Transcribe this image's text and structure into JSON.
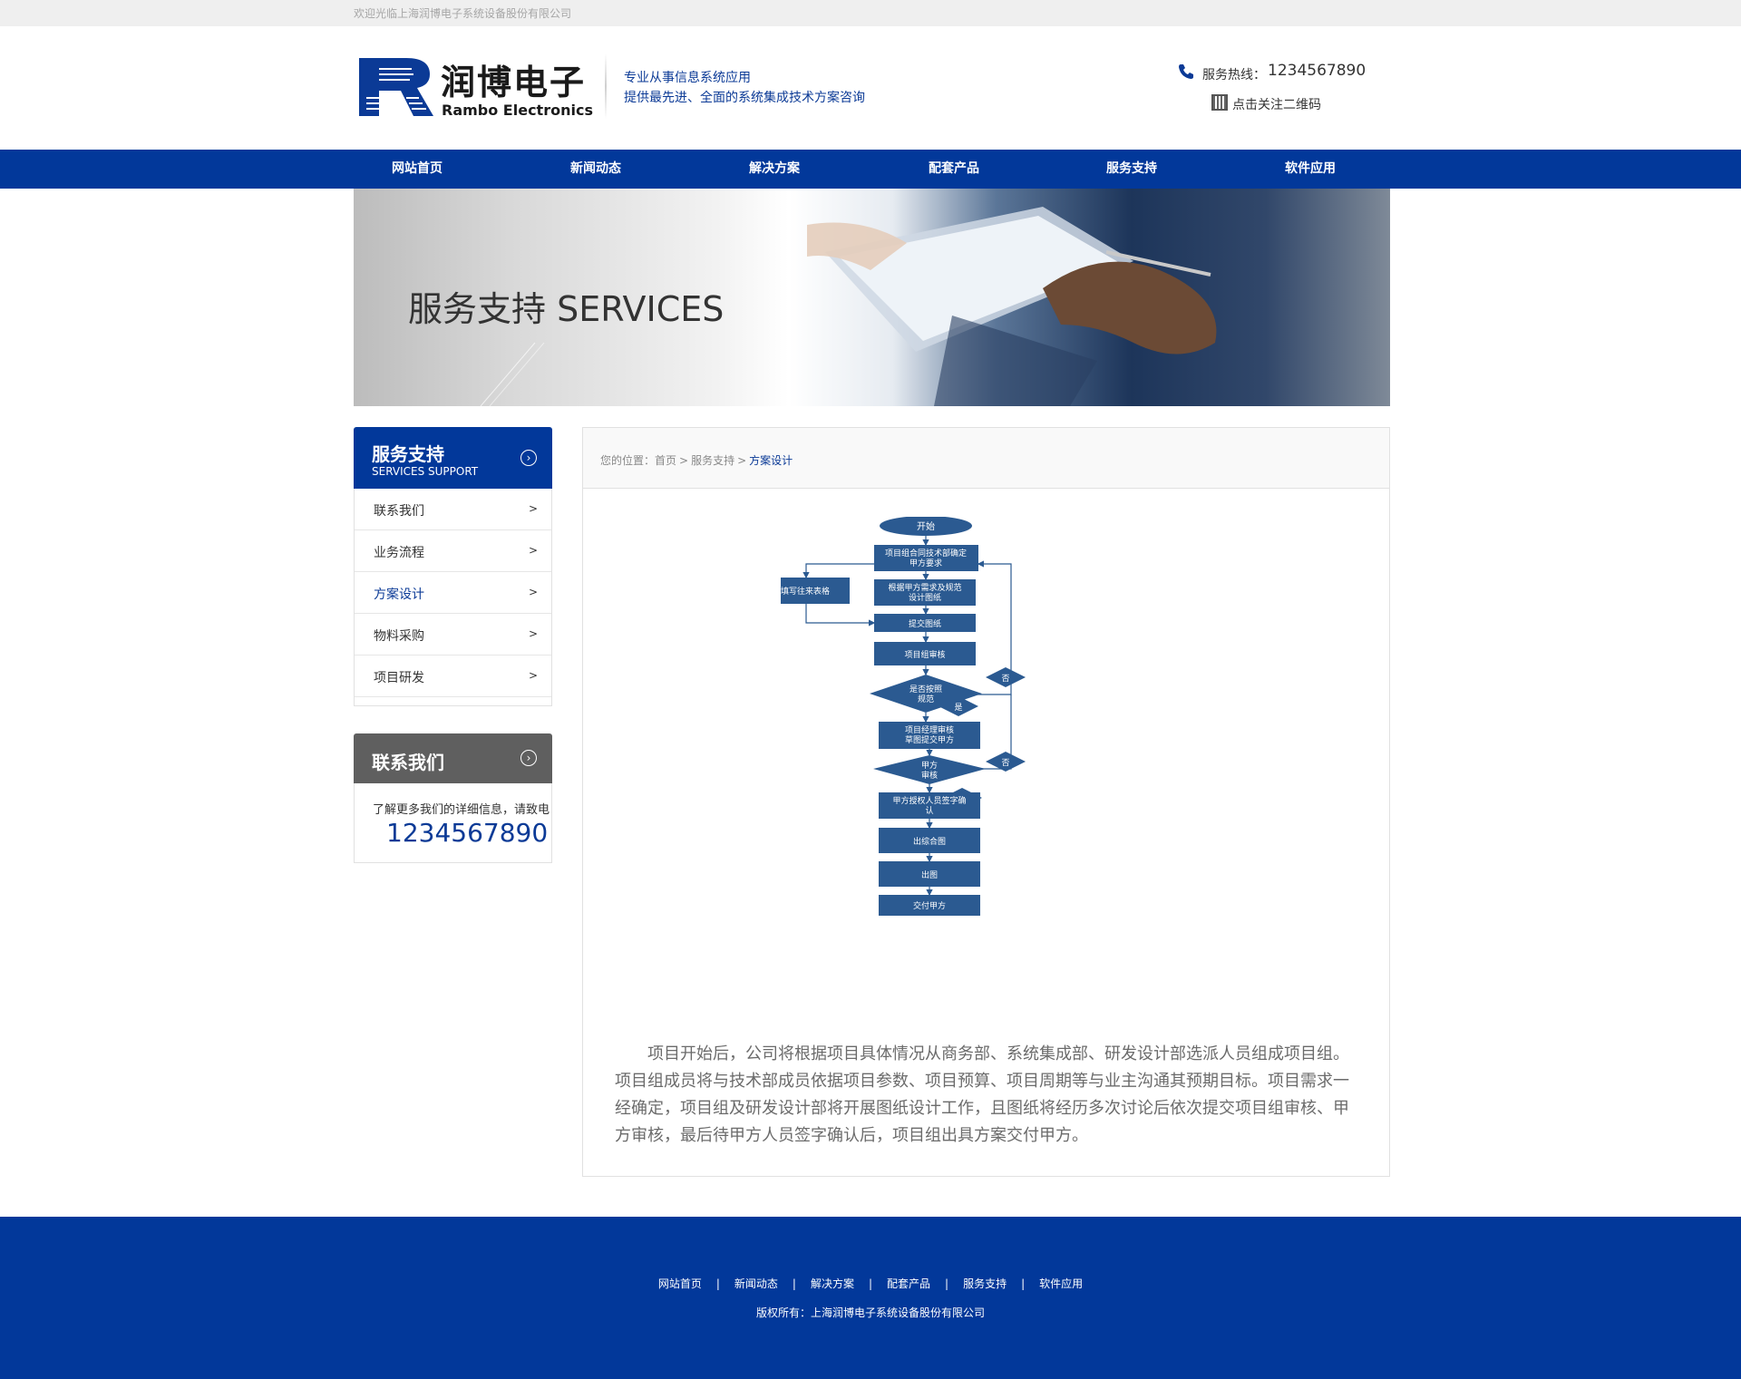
{
  "topbar": {
    "welcome": "欢迎光临上海润博电子系统设备股份有限公司"
  },
  "header": {
    "logo_cn": "润博电子",
    "logo_en": "Rambo Electronics",
    "slogan_line1": "专业从事信息系统应用",
    "slogan_line2": "提供最先进、全面的系统集成技术方案咨询",
    "hotline_label": "服务热线：",
    "hotline_number": "1234567890",
    "qr_label": "点击关注二维码"
  },
  "nav": {
    "items": [
      {
        "label": "网站首页"
      },
      {
        "label": "新闻动态"
      },
      {
        "label": "解决方案"
      },
      {
        "label": "配套产品"
      },
      {
        "label": "服务支持"
      },
      {
        "label": "软件应用"
      }
    ]
  },
  "banner": {
    "title": "服务支持 SERVICES"
  },
  "sidebar": {
    "title": "服务支持",
    "subtitle": "SERVICES SUPPORT",
    "items": [
      {
        "label": "联系我们",
        "arrow": ">"
      },
      {
        "label": "业务流程",
        "arrow": ">"
      },
      {
        "label": "方案设计",
        "arrow": ">",
        "active": true
      },
      {
        "label": "物料采购",
        "arrow": ">"
      },
      {
        "label": "项目研发",
        "arrow": ">"
      }
    ]
  },
  "contact": {
    "title": "联系我们",
    "desc": "了解更多我们的详细信息，请致电",
    "number": "1234567890"
  },
  "breadcrumb": {
    "prefix": "您的位置：",
    "home": "首页",
    "section": "服务支持",
    "current": "方案设计"
  },
  "flowchart": {
    "start": "开始",
    "step1": [
      "项目组合同技术部确定",
      "甲方要求"
    ],
    "side_box": "填写往来表格",
    "step2": [
      "根据甲方需求及规范",
      "设计图纸"
    ],
    "step3": "提交图纸",
    "step4": "项目组审核",
    "decision1": [
      "是否按照",
      "规范"
    ],
    "no1": "否",
    "yes1": "是",
    "step5": [
      "项目经理审核",
      "草图提交甲方"
    ],
    "decision2": [
      "甲方",
      "审核"
    ],
    "no2": "否",
    "yes2": "是",
    "step6": [
      "甲方授权人员签字确",
      "认"
    ],
    "step7": "出综合图",
    "step8": "出图",
    "step9": "交付甲方"
  },
  "article": {
    "text": "项目开始后，公司将根据项目具体情况从商务部、系统集成部、研发设计部选派人员组成项目组。项目组成员将与技术部成员依据项目参数、项目预算、项目周期等与业主沟通其预期目标。项目需求一经确定，项目组及研发设计部将开展图纸设计工作，且图纸将经历多次讨论后依次提交项目组审核、甲方审核，最后待甲方人员签字确认后，项目组出具方案交付甲方。"
  },
  "footer": {
    "links": [
      "网站首页",
      "新闻动态",
      "解决方案",
      "配套产品",
      "服务支持",
      "软件应用"
    ],
    "separator": "|",
    "copyright": "版权所有：上海润博电子系统设备股份有限公司"
  },
  "colors": {
    "brand_blue": "#02389a",
    "flow_box": "#2b5a91",
    "footer_bg": "#02389a"
  }
}
